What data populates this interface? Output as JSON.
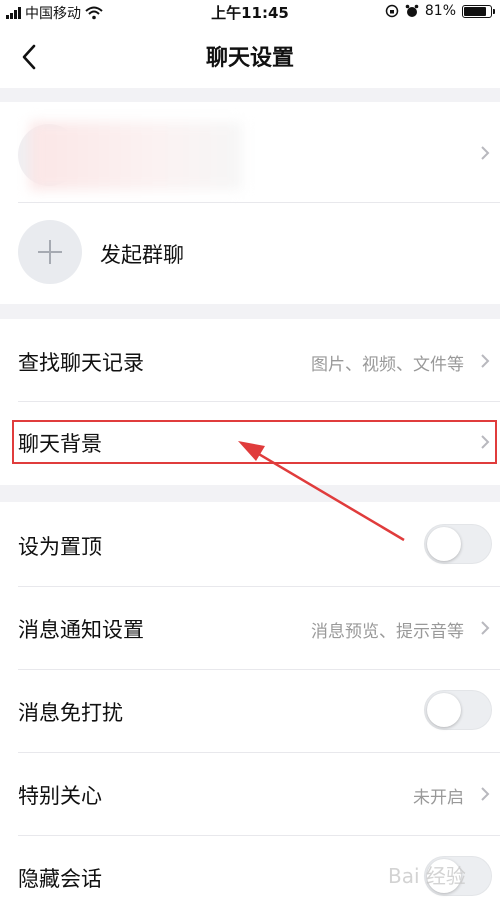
{
  "status_bar": {
    "carrier": "中国移动",
    "time": "上午11:45",
    "battery": "81%",
    "icons": [
      "signal-icon",
      "wifi-icon",
      "rotation-lock-icon",
      "alarm-icon",
      "battery-icon"
    ]
  },
  "nav": {
    "title": "聊天设置",
    "back_icon": "chevron-left-icon"
  },
  "group": {
    "start_group_chat": "发起群聊"
  },
  "menu": {
    "search_history": {
      "label": "查找聊天记录",
      "value": "图片、视频、文件等"
    },
    "chat_background": {
      "label": "聊天背景"
    },
    "pin_top": {
      "label": "设为置顶",
      "on": false
    },
    "notification": {
      "label": "消息通知设置",
      "value": "消息预览、提示音等"
    },
    "dnd": {
      "label": "消息免打扰",
      "on": false
    },
    "special_care": {
      "label": "特别关心",
      "value": "未开启"
    },
    "hide_chat": {
      "label": "隐藏会话",
      "on": false
    }
  },
  "annotation": {
    "highlight_color": "#e03c3c"
  },
  "watermark": {
    "text": "Bai 经验"
  }
}
